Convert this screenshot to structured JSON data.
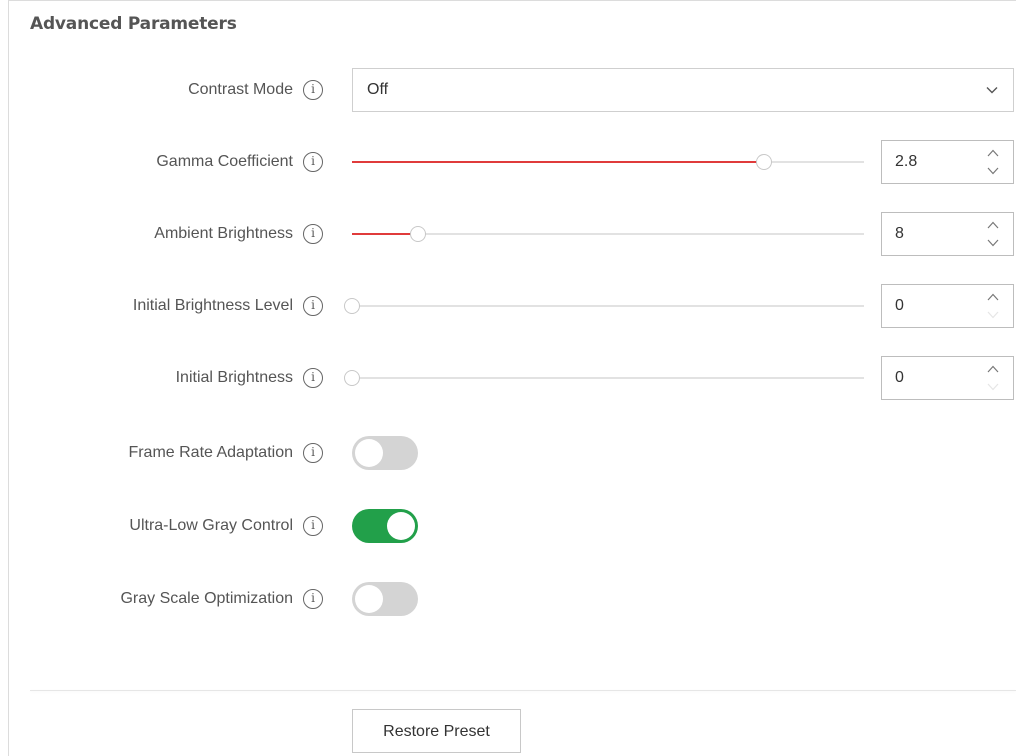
{
  "section_title": "Advanced Parameters",
  "colors": {
    "slider_fill": "#e03b3b",
    "toggle_on": "#22a04a",
    "toggle_off": "#d4d4d4"
  },
  "contrast_mode": {
    "label": "Contrast Mode",
    "value": "Off"
  },
  "gamma_coefficient": {
    "label": "Gamma Coefficient",
    "value": "2.8",
    "level": 0.805
  },
  "ambient_brightness": {
    "label": "Ambient Brightness",
    "value": "8",
    "level": 0.128
  },
  "initial_brightness_level": {
    "label": "Initial Brightness Level",
    "value": "0",
    "level": 0
  },
  "initial_brightness": {
    "label": "Initial Brightness",
    "value": "0",
    "level": 0
  },
  "frame_rate_adaptation": {
    "label": "Frame Rate Adaptation",
    "enabled": false
  },
  "ultra_low_gray_control": {
    "label": "Ultra-Low Gray Control",
    "enabled": true
  },
  "gray_scale_optimization": {
    "label": "Gray Scale Optimization",
    "enabled": false
  },
  "info_icon_glyph": "i",
  "footer": {
    "restore_label": "Restore Preset"
  }
}
